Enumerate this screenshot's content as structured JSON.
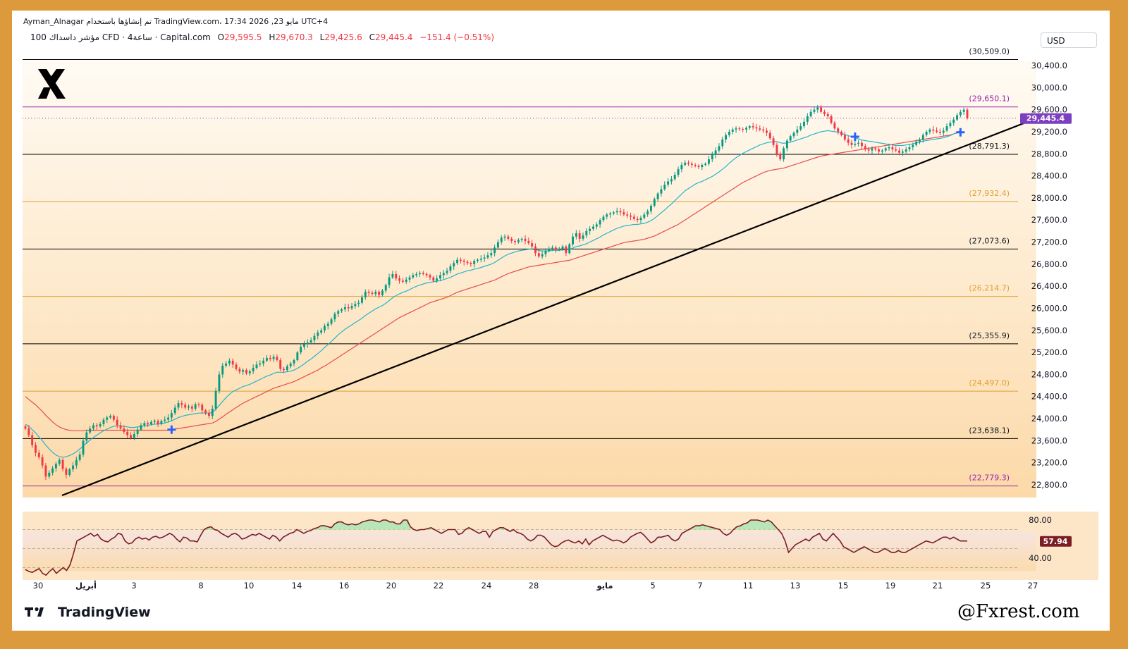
{
  "header": {
    "author_line": "Ayman_Alnagar تم إنشاؤها باستخدام TradingView.com، 17:34 2026 ,23 مايو UTC+4",
    "symbol_line": "100 مؤشر داسداك CFD · 4ساعة · Capital.com",
    "ohlc": {
      "o_label": "O",
      "o": "29,595.5",
      "h_label": "H",
      "h": "29,670.3",
      "l_label": "L",
      "l": "29,425.6",
      "c_label": "C",
      "c": "29,445.4",
      "change": "−151.4 (−0.51%)"
    }
  },
  "currency": "USD",
  "brand": "TradingView",
  "handle": "@Fxrest.com",
  "logo_icon": "x-logo-icon",
  "colors": {
    "frame": "#dc9a3c",
    "up": "#089981",
    "down": "#f23645",
    "ema_fast": "#26b5c9",
    "ema_slow": "#e84c4c",
    "trendline": "#000000",
    "rsi": "#7a1e24",
    "last_price": "#7b3fbf"
  },
  "chart_data": [
    {
      "type": "candlestick",
      "title": "",
      "y_axis_ticks": [
        "30,400.0",
        "30,000.0",
        "29,600.0",
        "29,200.0",
        "28,800.0",
        "28,400.0",
        "28,000.0",
        "27,600.0",
        "27,200.0",
        "26,800.0",
        "26,400.0",
        "26,000.0",
        "25,600.0",
        "25,200.0",
        "24,800.0",
        "24,400.0",
        "24,000.0",
        "23,600.0",
        "23,200.0",
        "22,800.0"
      ],
      "ylim": [
        22600,
        30800
      ],
      "x_axis_ticks": [
        "30",
        "أبريل",
        "3",
        "8",
        "10",
        "14",
        "16",
        "20",
        "22",
        "24",
        "28",
        "مايو",
        "5",
        "7",
        "11",
        "13",
        "15",
        "19",
        "21",
        "25",
        "27"
      ],
      "last_price_label": "29,445.4",
      "fib_levels": [
        {
          "label": "(30,509.0)",
          "value": 30509.0,
          "color": "#000000"
        },
        {
          "label": "(29,650.1)",
          "value": 29650.1,
          "color": "#9c27b0"
        },
        {
          "label": "(28,791.3)",
          "value": 28791.3,
          "color": "#000000"
        },
        {
          "label": "(27,932.4)",
          "value": 27932.4,
          "color": "#e0a030"
        },
        {
          "label": "(27,073.6)",
          "value": 27073.6,
          "color": "#000000"
        },
        {
          "label": "(26,214.7)",
          "value": 26214.7,
          "color": "#e0a030"
        },
        {
          "label": "(25,355.9)",
          "value": 25355.9,
          "color": "#000000"
        },
        {
          "label": "(24,497.0)",
          "value": 24497.0,
          "color": "#e0a030"
        },
        {
          "label": "(23,638.1)",
          "value": 23638.1,
          "color": "#000000"
        },
        {
          "label": "(22,779.3)",
          "value": 22779.3,
          "color": "#9c27b0"
        }
      ],
      "close_series": [
        23820,
        23700,
        23520,
        23380,
        23300,
        23150,
        22950,
        23020,
        23100,
        23180,
        23250,
        23090,
        22980,
        23080,
        23150,
        23250,
        23350,
        23600,
        23750,
        23820,
        23880,
        23860,
        23900,
        23980,
        24020,
        24050,
        23980,
        23880,
        23820,
        23760,
        23700,
        23650,
        23720,
        23800,
        23880,
        23920,
        23900,
        23940,
        23960,
        23900,
        23960,
        23980,
        24020,
        24100,
        24200,
        24280,
        24250,
        24200,
        24220,
        24180,
        24260,
        24250,
        24150,
        24100,
        24050,
        24180,
        24500,
        24800,
        24960,
        25000,
        25050,
        24980,
        24900,
        24850,
        24880,
        24820,
        24860,
        24920,
        24980,
        25000,
        25050,
        25100,
        25080,
        25120,
        25060,
        24900,
        24880,
        24950,
        25000,
        25060,
        25200,
        25300,
        25350,
        25380,
        25420,
        25500,
        25560,
        25600,
        25680,
        25720,
        25800,
        25900,
        25950,
        25980,
        26020,
        26000,
        26040,
        26080,
        26100,
        26200,
        26300,
        26280,
        26260,
        26300,
        26240,
        26320,
        26420,
        26560,
        26620,
        26540,
        26500,
        26480,
        26520,
        26560,
        26600,
        26620,
        26640,
        26620,
        26600,
        26560,
        26500,
        26540,
        26600,
        26640,
        26680,
        26760,
        26820,
        26880,
        26860,
        26840,
        26820,
        26800,
        26860,
        26880,
        26900,
        26920,
        26960,
        27000,
        27100,
        27200,
        27280,
        27300,
        27260,
        27220,
        27200,
        27240,
        27260,
        27220,
        27180,
        27120,
        27000,
        26940,
        26980,
        27040,
        27080,
        27100,
        27060,
        27080,
        27120,
        27000,
        27160,
        27300,
        27360,
        27260,
        27320,
        27400,
        27440,
        27480,
        27520,
        27600,
        27660,
        27700,
        27720,
        27740,
        27760,
        27740,
        27700,
        27680,
        27660,
        27620,
        27600,
        27640,
        27700,
        27760,
        27860,
        27980,
        28080,
        28160,
        28240,
        28300,
        28340,
        28420,
        28520,
        28600,
        28640,
        28620,
        28600,
        28580,
        28560,
        28600,
        28620,
        28700,
        28780,
        28860,
        28940,
        29060,
        29140,
        29200,
        29240,
        29260,
        29250,
        29240,
        29270,
        29300,
        29280,
        29260,
        29240,
        29220,
        29180,
        29080,
        28960,
        28800,
        28700,
        28900,
        29040,
        29120,
        29180,
        29240,
        29300,
        29380,
        29480,
        29560,
        29600,
        29640,
        29560,
        29520,
        29480,
        29360,
        29260,
        29200,
        29140,
        29060,
        29000,
        28960,
        28980,
        29000,
        28940,
        28880,
        28860,
        28900,
        28880,
        28840,
        28860,
        28900,
        28920,
        28880,
        28860,
        28820,
        28840,
        28880,
        28920,
        28960,
        29020,
        29060,
        29140,
        29200,
        29240,
        29220,
        29200,
        29180,
        29220,
        29300,
        29360,
        29420,
        29500,
        29560,
        29600,
        29445.4
      ],
      "ema_fast": [
        23900,
        23860,
        23800,
        23740,
        23670,
        23600,
        23520,
        23450,
        23390,
        23340,
        23310,
        23300,
        23310,
        23330,
        23360,
        23400,
        23450,
        23500,
        23560,
        23610,
        23660,
        23700,
        23740,
        23780,
        23810,
        23840,
        23860,
        23870,
        23870,
        23860,
        23850,
        23840,
        23840,
        23850,
        23860,
        23870,
        23880,
        23890,
        23900,
        23900,
        23910,
        23920,
        23940,
        23960,
        23990,
        24020,
        24040,
        24060,
        24070,
        24080,
        24090,
        24100,
        24100,
        24100,
        24100,
        24110,
        24170,
        24240,
        24310,
        24380,
        24440,
        24490,
        24520,
        24550,
        24580,
        24600,
        24620,
        24650,
        24680,
        24710,
        24740,
        24770,
        24790,
        24820,
        24840,
        24840,
        24840,
        24850,
        24860,
        24880,
        24910,
        24950,
        24990,
        25040,
        25080,
        25130,
        25180,
        25230,
        25290,
        25340,
        25400,
        25460,
        25520,
        25570,
        25620,
        25660,
        25700,
        25740,
        25780,
        25820,
        25870,
        25910,
        25950,
        25990,
        26020,
        26050,
        26090,
        26140,
        26190,
        26230,
        26260,
        26290,
        26310,
        26340,
        26370,
        26400,
        26420,
        26440,
        26460,
        26470,
        26480,
        26490,
        26500,
        26520,
        26540,
        26560,
        26590,
        26620,
        26640,
        26660,
        26680,
        26690,
        26710,
        26720,
        26740,
        26760,
        26780,
        26800,
        26830,
        26870,
        26910,
        26950,
        26980,
        27000,
        27020,
        27040,
        27050,
        27060,
        27070,
        27070,
        27060,
        27050,
        27040,
        27040,
        27040,
        27050,
        27050,
        27050,
        27060,
        27060,
        27070,
        27090,
        27120,
        27130,
        27150,
        27170,
        27200,
        27230,
        27260,
        27290,
        27330,
        27360,
        27390,
        27420,
        27450,
        27470,
        27490,
        27500,
        27510,
        27520,
        27520,
        27530,
        27540,
        27560,
        27590,
        27630,
        27680,
        27730,
        27780,
        27840,
        27890,
        27950,
        28010,
        28070,
        28130,
        28170,
        28210,
        28250,
        28280,
        28300,
        28330,
        28360,
        28390,
        28430,
        28470,
        28520,
        28570,
        28630,
        28680,
        28730,
        28770,
        28810,
        28840,
        28870,
        28900,
        28930,
        28960,
        28980,
        29000,
        29010,
        29020,
        29020,
        29000,
        28990,
        29000,
        29010,
        29030,
        29050,
        29070,
        29090,
        29110,
        29140,
        29160,
        29180,
        29200,
        29210,
        29220,
        29210,
        29200,
        29190,
        29170,
        29150,
        29130,
        29110,
        29090,
        29070,
        29050,
        29040,
        29030,
        29020,
        29010,
        29000,
        28990,
        28980,
        28970,
        28960,
        28950,
        28950,
        28950,
        28960,
        28970,
        28980,
        29000,
        29010,
        29030,
        29040,
        29050,
        29060,
        29070,
        29080,
        29090,
        29110,
        29130,
        29160,
        29190,
        29220
      ],
      "ema_slow": [
        24400,
        24350,
        24300,
        24250,
        24190,
        24130,
        24060,
        24000,
        23940,
        23890,
        23850,
        23820,
        23800,
        23790,
        23780,
        23780,
        23780,
        23780,
        23790,
        23790,
        23790,
        23790,
        23790,
        23790,
        23790,
        23790,
        23790,
        23790,
        23790,
        23790,
        23790,
        23790,
        23790,
        23790,
        23790,
        23790,
        23790,
        23790,
        23790,
        23790,
        23790,
        23790,
        23790,
        23800,
        23810,
        23820,
        23830,
        23840,
        23850,
        23860,
        23870,
        23880,
        23890,
        23900,
        23910,
        23920,
        23950,
        23990,
        24030,
        24080,
        24120,
        24160,
        24200,
        24240,
        24280,
        24310,
        24340,
        24370,
        24400,
        24430,
        24460,
        24490,
        24520,
        24550,
        24570,
        24590,
        24610,
        24630,
        24650,
        24670,
        24700,
        24730,
        24760,
        24790,
        24820,
        24850,
        24880,
        24920,
        24950,
        24990,
        25030,
        25070,
        25110,
        25150,
        25190,
        25230,
        25270,
        25310,
        25350,
        25390,
        25430,
        25470,
        25510,
        25550,
        25590,
        25630,
        25670,
        25710,
        25750,
        25790,
        25830,
        25860,
        25890,
        25920,
        25950,
        25980,
        26010,
        26040,
        26070,
        26100,
        26120,
        26140,
        26160,
        26180,
        26200,
        26230,
        26260,
        26290,
        26310,
        26330,
        26350,
        26370,
        26390,
        26410,
        26430,
        26450,
        26470,
        26490,
        26510,
        26540,
        26570,
        26600,
        26630,
        26650,
        26670,
        26690,
        26710,
        26730,
        26750,
        26760,
        26770,
        26780,
        26790,
        26800,
        26810,
        26820,
        26830,
        26840,
        26850,
        26860,
        26870,
        26890,
        26910,
        26930,
        26950,
        26970,
        26990,
        27010,
        27030,
        27050,
        27070,
        27090,
        27110,
        27130,
        27150,
        27170,
        27190,
        27200,
        27210,
        27220,
        27230,
        27240,
        27250,
        27270,
        27290,
        27310,
        27340,
        27370,
        27400,
        27430,
        27460,
        27490,
        27520,
        27560,
        27600,
        27640,
        27680,
        27720,
        27760,
        27800,
        27840,
        27880,
        27920,
        27960,
        28000,
        28040,
        28080,
        28120,
        28160,
        28200,
        28240,
        28280,
        28310,
        28340,
        28370,
        28400,
        28430,
        28460,
        28480,
        28500,
        28510,
        28520,
        28530,
        28540,
        28560,
        28580,
        28600,
        28620,
        28640,
        28660,
        28680,
        28700,
        28720,
        28740,
        28760,
        28770,
        28780,
        28790,
        28800,
        28810,
        28820,
        28830,
        28840,
        28850,
        28860,
        28870,
        28880,
        28890,
        28900,
        28910,
        28920,
        28930,
        28940,
        28950,
        28960,
        28970,
        28980,
        28990,
        29000,
        29010,
        29020,
        29030,
        29040,
        29050,
        29060,
        29070,
        29080,
        29090,
        29100,
        29110,
        29120,
        29130,
        29140,
        29160,
        29180
      ]
    },
    {
      "type": "line",
      "title": "",
      "name": "RSI",
      "y_axis_ticks": [
        "80.00",
        "40.00"
      ],
      "ylim": [
        20,
        100
      ],
      "bands": [
        30,
        50,
        70
      ],
      "last_value_label": "57.94",
      "values": [
        28,
        26,
        25,
        27,
        29,
        24,
        22,
        26,
        29,
        24,
        27,
        30,
        27,
        33,
        45,
        58,
        60,
        62,
        64,
        66,
        63,
        65,
        60,
        58,
        57,
        60,
        62,
        66,
        65,
        58,
        55,
        56,
        60,
        62,
        60,
        61,
        59,
        62,
        63,
        61,
        62,
        64,
        66,
        64,
        60,
        57,
        62,
        61,
        58,
        58,
        57,
        64,
        70,
        72,
        73,
        70,
        69,
        66,
        64,
        62,
        65,
        66,
        64,
        60,
        61,
        63,
        65,
        64,
        66,
        64,
        62,
        60,
        64,
        62,
        58,
        62,
        64,
        66,
        67,
        70,
        68,
        66,
        68,
        69,
        71,
        72,
        74,
        74,
        73,
        72,
        76,
        78,
        78,
        76,
        75,
        76,
        75,
        76,
        78,
        79,
        80,
        80,
        79,
        78,
        80,
        80,
        78,
        78,
        76,
        76,
        80,
        80,
        73,
        70,
        69,
        70,
        70,
        71,
        72,
        70,
        68,
        66,
        68,
        70,
        70,
        70,
        65,
        66,
        70,
        72,
        70,
        68,
        66,
        68,
        68,
        62,
        68,
        70,
        72,
        72,
        70,
        68,
        70,
        67,
        66,
        64,
        60,
        58,
        60,
        64,
        64,
        62,
        58,
        54,
        52,
        53,
        56,
        58,
        59,
        57,
        56,
        58,
        55,
        60,
        54,
        58,
        60,
        62,
        64,
        62,
        60,
        58,
        59,
        58,
        56,
        58,
        62,
        64,
        66,
        67,
        64,
        60,
        56,
        58,
        62,
        62,
        63,
        64,
        60,
        58,
        60,
        66,
        68,
        70,
        72,
        74,
        74,
        75,
        74,
        73,
        72,
        71,
        70,
        66,
        64,
        66,
        70,
        73,
        74,
        76,
        77,
        80,
        80,
        80,
        79,
        78,
        80,
        78,
        74,
        70,
        66,
        58,
        46,
        50,
        54,
        56,
        58,
        60,
        58,
        62,
        64,
        66,
        60,
        58,
        62,
        66,
        62,
        58,
        52,
        50,
        48,
        46,
        48,
        50,
        52,
        50,
        48,
        46,
        46,
        48,
        50,
        48,
        46,
        46,
        48,
        46,
        46,
        48,
        50,
        52,
        54,
        56,
        58,
        57,
        56,
        58,
        60,
        62,
        62,
        60,
        62,
        60,
        58,
        58,
        57.94
      ]
    }
  ]
}
